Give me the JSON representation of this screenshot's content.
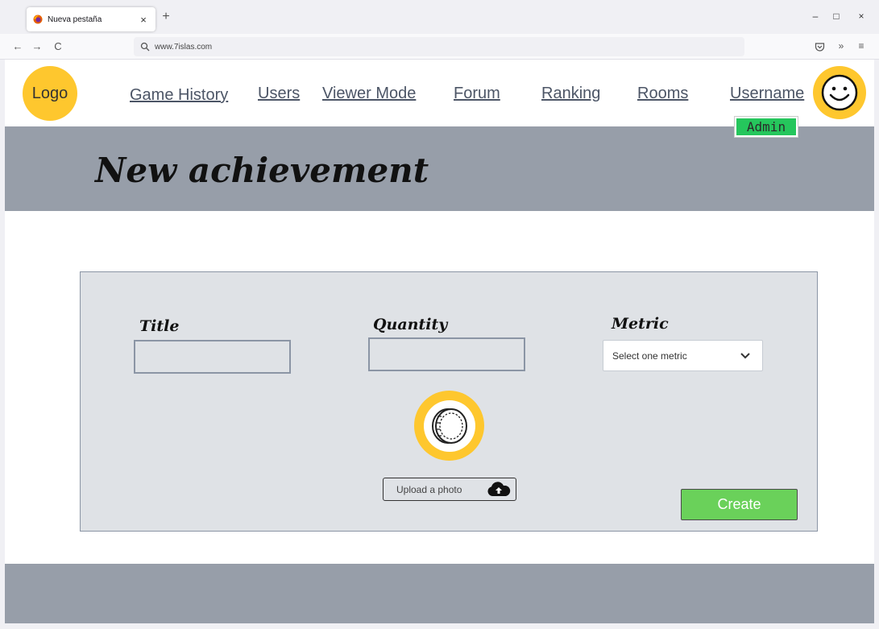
{
  "browser": {
    "tab_title": "Nueva pestaña",
    "tab_close": "×",
    "new_tab": "+",
    "url": "www.7islas.com",
    "window_controls": {
      "minimize": "–",
      "maximize": "□",
      "close": "×"
    },
    "nav": {
      "back": "←",
      "forward": "→",
      "reload": "C"
    },
    "tools": {
      "more": "»",
      "menu": "≡"
    }
  },
  "header": {
    "logo": "Logo",
    "nav": {
      "game_history": "Game History",
      "users": "Users",
      "viewer_mode": "Viewer Mode",
      "forum": "Forum",
      "ranking": "Ranking",
      "rooms": "Rooms",
      "username": "Username"
    },
    "role_badge": "Admin"
  },
  "hero": {
    "title": "New achievement"
  },
  "form": {
    "title_label": "Title",
    "title_value": "",
    "quantity_label": "Quantity",
    "quantity_value": "",
    "metric_label": "Metric",
    "metric_placeholder": "Select one metric",
    "upload_label": "Upload a photo",
    "create_label": "Create"
  },
  "colors": {
    "accent_yellow": "#fec72e",
    "header_gray": "#979ea9",
    "panel_bg": "#dfe2e6",
    "create_green": "#6ad15a",
    "admin_green": "#25c65c"
  },
  "icons": [
    "firefox-icon",
    "search-icon",
    "pocket-icon",
    "smiley-icon",
    "coin-icon",
    "chevron-down-icon",
    "cloud-upload-icon"
  ]
}
